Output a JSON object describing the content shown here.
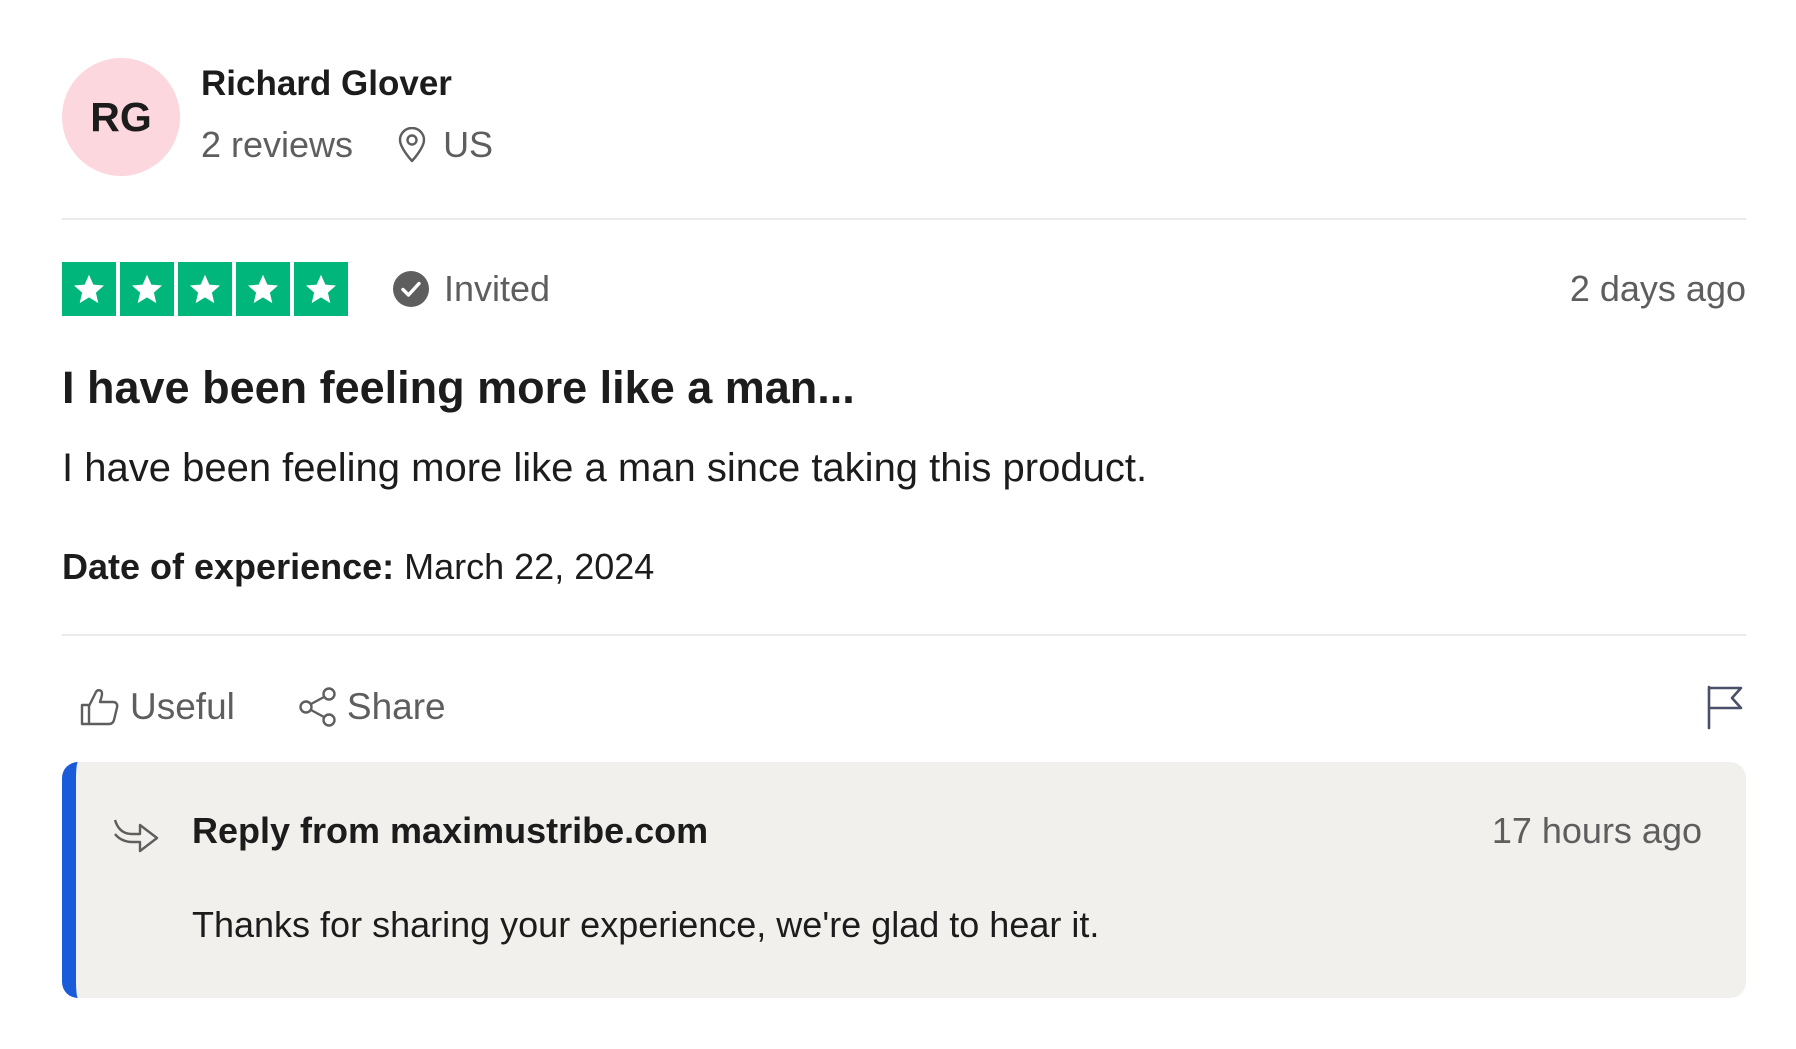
{
  "reviewer": {
    "initials": "RG",
    "name": "Richard Glover",
    "reviews_count": "2 reviews",
    "country": "US",
    "avatar_color": "#fcd7de"
  },
  "review": {
    "rating": 5,
    "rating_max": 5,
    "star_color": "#00b67a",
    "invited_label": "Invited",
    "date": "2 days ago",
    "title": "I have been feeling more like a man...",
    "body": "I have been feeling more like a man since taking this product.",
    "experience_label": "Date of experience:",
    "experience_date": "March 22, 2024"
  },
  "actions": {
    "useful_label": "Useful",
    "share_label": "Share",
    "icons": [
      "thumbs-up-icon",
      "share-icon",
      "flag-icon"
    ]
  },
  "reply": {
    "from_label": "Reply from maximustribe.com",
    "date": "17 hours ago",
    "text": "Thanks for sharing your experience, we're glad to hear it.",
    "accent_color": "#1a5bd9",
    "background_color": "#f1f0ec"
  }
}
